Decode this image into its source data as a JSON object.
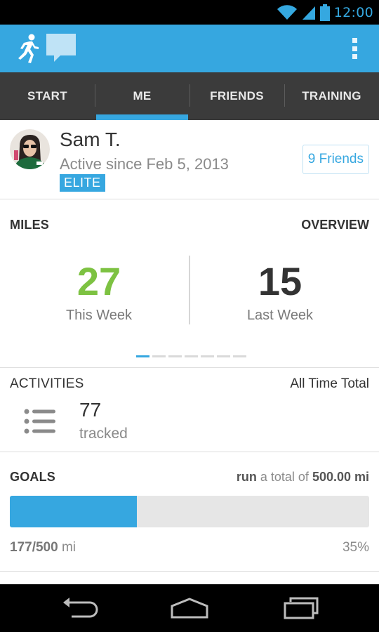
{
  "status_bar": {
    "time": "12:00",
    "icons": [
      "wifi-icon",
      "signal-icon",
      "battery-icon"
    ]
  },
  "action_bar": {
    "icons": [
      "runner-logo-icon",
      "chat-bubble-icon",
      "overflow-menu-icon"
    ]
  },
  "tabs": [
    {
      "label": "START",
      "active": false
    },
    {
      "label": "ME",
      "active": true
    },
    {
      "label": "FRIENDS",
      "active": false
    },
    {
      "label": "TRAINING",
      "active": false
    }
  ],
  "profile": {
    "name": "Sam T.",
    "active_since": "Active since Feb 5, 2013",
    "badge": "ELITE",
    "friends_button": "9 Friends"
  },
  "miles": {
    "title": "MILES",
    "overview_link": "OVERVIEW",
    "this_week": {
      "value": "27",
      "label": "This Week",
      "color": "#7dc242"
    },
    "last_week": {
      "value": "15",
      "label": "Last Week",
      "color": "#333333"
    },
    "pager": {
      "pages": 7,
      "current": 1
    }
  },
  "activities": {
    "title": "ACTIVITIES",
    "scope": "All Time Total",
    "count": "77",
    "count_label": "tracked",
    "icon": "list-icon"
  },
  "goals": {
    "title": "GOALS",
    "desc_verb": "run",
    "desc_middle": " a total of ",
    "desc_target": "500.00 mi",
    "progress_done": "177",
    "progress_total": "500",
    "progress_unit": " mi",
    "progress_fraction": 0.354,
    "percent": "35%"
  },
  "nav_bar": {
    "icons": [
      "back-icon",
      "home-icon",
      "recent-apps-icon"
    ]
  },
  "colors": {
    "accent": "#36a7e0",
    "tab_bar": "#3b3b3b",
    "positive": "#7dc242"
  }
}
